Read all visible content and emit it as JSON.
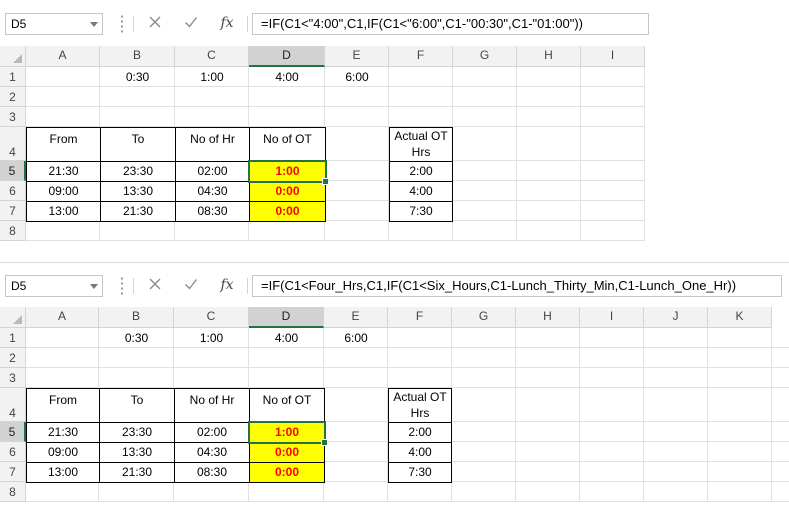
{
  "panels": [
    {
      "name_box": "D5",
      "formula": "=IF(C1<\"4:00\",C1,IF(C1<\"6:00\",C1-\"00:30\",C1-\"01:00\"))",
      "fx_label": "fx",
      "columns": [
        "A",
        "B",
        "C",
        "D",
        "E",
        "F",
        "G",
        "H",
        "I"
      ],
      "rows": [
        "1",
        "2",
        "3",
        "4",
        "5",
        "6",
        "7",
        "8"
      ],
      "row1": {
        "B": "0:30",
        "C": "1:00",
        "D": "4:00",
        "E": "6:00"
      },
      "table_headers": [
        "From",
        "To",
        "No of Hr",
        "No of OT"
      ],
      "table_rows": [
        [
          "21:30",
          "23:30",
          "02:00",
          "1:00"
        ],
        [
          "09:00",
          "13:30",
          "04:30",
          "0:00"
        ],
        [
          "13:00",
          "21:30",
          "08:30",
          "0:00"
        ]
      ],
      "actual_header": "Actual OT Hrs",
      "actual_values": [
        "2:00",
        "4:00",
        "7:30"
      ]
    },
    {
      "name_box": "D5",
      "formula": "=IF(C1<Four_Hrs,C1,IF(C1<Six_Hours,C1-Lunch_Thirty_Min,C1-Lunch_One_Hr))",
      "fx_label": "fx",
      "columns": [
        "A",
        "B",
        "C",
        "D",
        "E",
        "F",
        "G",
        "H",
        "I",
        "J",
        "K"
      ],
      "rows": [
        "1",
        "2",
        "3",
        "4",
        "5",
        "6",
        "7",
        "8"
      ],
      "row1": {
        "B": "0:30",
        "C": "1:00",
        "D": "4:00",
        "E": "6:00"
      },
      "table_headers": [
        "From",
        "To",
        "No of Hr",
        "No of OT"
      ],
      "table_rows": [
        [
          "21:30",
          "23:30",
          "02:00",
          "1:00"
        ],
        [
          "09:00",
          "13:30",
          "04:30",
          "0:00"
        ],
        [
          "13:00",
          "21:30",
          "08:30",
          "0:00"
        ]
      ],
      "actual_header": "Actual OT Hrs",
      "actual_values": [
        "2:00",
        "4:00",
        "7:30"
      ]
    }
  ],
  "colors": {
    "selection": "#217346",
    "highlight_fill": "#ffff00",
    "highlight_text": "#ff0000"
  },
  "icons": [
    "chevron-down-icon",
    "cancel-x-icon",
    "check-icon",
    "fx-icon",
    "select-all-triangle-icon"
  ]
}
